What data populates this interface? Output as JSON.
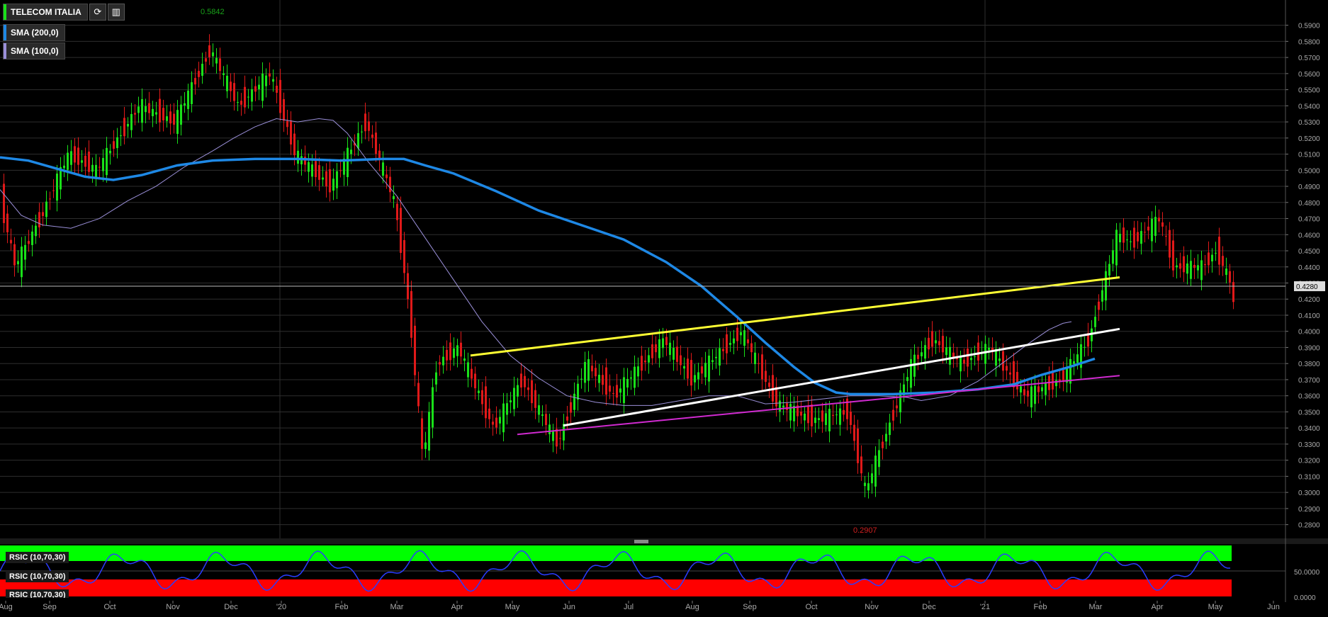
{
  "header": {
    "symbol": "TELECOM ITALIA",
    "indicators": [
      {
        "label": "SMA (200,0)",
        "color": "#1e88e5"
      },
      {
        "label": "SMA (100,0)",
        "color": "#9a8fd8"
      }
    ],
    "rsi_labels": [
      "RSIC (10,70,30)",
      "RSIC (10,70,30)",
      "RSIC (10,70,30)"
    ]
  },
  "colors": {
    "up": "#19e019",
    "down": "#e01919",
    "sma200": "#1e88e5",
    "sma100": "#9a8fd8",
    "yellow_trend": "#ffff33",
    "white_trend": "#ffffff",
    "magenta_trend": "#d02ad0",
    "rsi_upper": "#00ff00",
    "rsi_lower": "#ff0000",
    "rsi_line": "#2a3cff"
  },
  "chart_data": {
    "type": "line",
    "title": "TELECOM ITALIA",
    "price_axis_ticks": [
      "0.5900",
      "0.5800",
      "0.5700",
      "0.5600",
      "0.5500",
      "0.5400",
      "0.5300",
      "0.5200",
      "0.5100",
      "0.5000",
      "0.4900",
      "0.4800",
      "0.4700",
      "0.4600",
      "0.4500",
      "0.4400",
      "0.4300",
      "0.4200",
      "0.4100",
      "0.4000",
      "0.3900",
      "0.3800",
      "0.3700",
      "0.3600",
      "0.3500",
      "0.3400",
      "0.3300",
      "0.3200",
      "0.3100",
      "0.3000",
      "0.2900",
      "0.2800"
    ],
    "ylim": [
      0.275,
      0.596
    ],
    "last_price": "0.4280",
    "high_label": "0.5842",
    "low_label": "0.2907",
    "x_labels": [
      "Aug",
      "Sep",
      "Oct",
      "Nov",
      "Dec",
      "'20",
      "Feb",
      "Mar",
      "Apr",
      "May",
      "Jun",
      "Jul",
      "Aug",
      "Sep",
      "Oct",
      "Nov",
      "Dec",
      "'21",
      "Feb",
      "Mar",
      "Apr",
      "May",
      "Jun"
    ],
    "rsi_axis_ticks": [
      "50.0000",
      "0.0000"
    ],
    "series": [
      {
        "name": "SMA (200,0)",
        "points": [
          [
            0,
            0.508
          ],
          [
            40,
            0.506
          ],
          [
            80,
            0.501
          ],
          [
            120,
            0.496
          ],
          [
            160,
            0.494
          ],
          [
            200,
            0.497
          ],
          [
            250,
            0.503
          ],
          [
            300,
            0.506
          ],
          [
            360,
            0.507
          ],
          [
            420,
            0.507
          ],
          [
            480,
            0.506
          ],
          [
            540,
            0.507
          ],
          [
            570,
            0.507
          ],
          [
            600,
            0.503
          ],
          [
            640,
            0.498
          ],
          [
            700,
            0.487
          ],
          [
            760,
            0.475
          ],
          [
            820,
            0.466
          ],
          [
            880,
            0.457
          ],
          [
            940,
            0.443
          ],
          [
            990,
            0.428
          ],
          [
            1040,
            0.409
          ],
          [
            1080,
            0.393
          ],
          [
            1120,
            0.378
          ],
          [
            1150,
            0.368
          ],
          [
            1180,
            0.362
          ],
          [
            1200,
            0.361
          ],
          [
            1260,
            0.361
          ],
          [
            1320,
            0.362
          ],
          [
            1380,
            0.364
          ],
          [
            1430,
            0.367
          ],
          [
            1470,
            0.373
          ],
          [
            1510,
            0.378
          ],
          [
            1545,
            0.383
          ]
        ]
      },
      {
        "name": "SMA (100,0)",
        "points": [
          [
            0,
            0.488
          ],
          [
            30,
            0.472
          ],
          [
            60,
            0.466
          ],
          [
            100,
            0.464
          ],
          [
            140,
            0.47
          ],
          [
            180,
            0.481
          ],
          [
            220,
            0.49
          ],
          [
            260,
            0.502
          ],
          [
            300,
            0.512
          ],
          [
            330,
            0.52
          ],
          [
            360,
            0.527
          ],
          [
            390,
            0.532
          ],
          [
            420,
            0.53
          ],
          [
            450,
            0.532
          ],
          [
            470,
            0.531
          ],
          [
            490,
            0.523
          ],
          [
            520,
            0.505
          ],
          [
            560,
            0.484
          ],
          [
            600,
            0.458
          ],
          [
            640,
            0.432
          ],
          [
            680,
            0.406
          ],
          [
            720,
            0.385
          ],
          [
            760,
            0.371
          ],
          [
            800,
            0.36
          ],
          [
            840,
            0.356
          ],
          [
            880,
            0.354
          ],
          [
            920,
            0.354
          ],
          [
            960,
            0.357
          ],
          [
            1000,
            0.36
          ],
          [
            1040,
            0.36
          ],
          [
            1080,
            0.355
          ],
          [
            1120,
            0.356
          ],
          [
            1160,
            0.358
          ],
          [
            1200,
            0.36
          ],
          [
            1240,
            0.36
          ],
          [
            1280,
            0.359
          ],
          [
            1300,
            0.357
          ],
          [
            1340,
            0.36
          ],
          [
            1380,
            0.369
          ],
          [
            1420,
            0.382
          ],
          [
            1450,
            0.392
          ],
          [
            1480,
            0.401
          ],
          [
            1500,
            0.405
          ],
          [
            1512,
            0.406
          ]
        ]
      }
    ],
    "trend_lines": [
      {
        "color": "yellow_trend",
        "from": [
          664,
          0.385
        ],
        "to": [
          1580,
          0.4335
        ]
      },
      {
        "color": "white_trend",
        "from": [
          795,
          0.3415
        ],
        "to": [
          1580,
          0.4015
        ]
      },
      {
        "color": "magenta_trend",
        "from": [
          730,
          0.336
        ],
        "to": [
          1580,
          0.3725
        ]
      }
    ]
  }
}
